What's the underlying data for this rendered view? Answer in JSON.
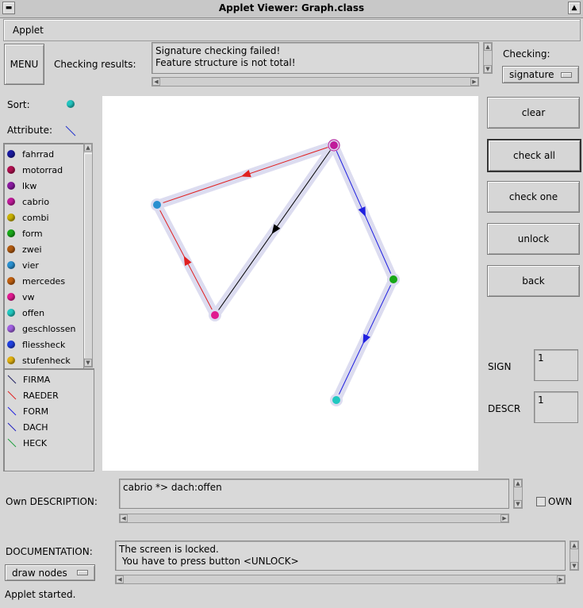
{
  "window": {
    "title": "Applet Viewer: Graph.class"
  },
  "menubar": {
    "applet_label": "Applet"
  },
  "header": {
    "menu_button": "MENU",
    "checking_results_label": "Checking results:",
    "results_text": "Signature checking failed!\nFeature structure is not total!",
    "checking_label": "Checking:",
    "checking_value": "signature"
  },
  "left": {
    "sort_label": "Sort:",
    "sort_color": "#22c5c0",
    "attribute_label": "Attribute:",
    "attribute_color": "#2233cc",
    "sorts": [
      {
        "label": "fahrrad",
        "color": "#1a1aa0"
      },
      {
        "label": "motorrad",
        "color": "#b01050"
      },
      {
        "label": "lkw",
        "color": "#8a1aa0"
      },
      {
        "label": "cabrio",
        "color": "#c01a9a"
      },
      {
        "label": "combi",
        "color": "#c8b000"
      },
      {
        "label": "form",
        "color": "#18a818"
      },
      {
        "label": "zwei",
        "color": "#b05a10"
      },
      {
        "label": "vier",
        "color": "#2a90d0"
      },
      {
        "label": "mercedes",
        "color": "#c06010"
      },
      {
        "label": "vw",
        "color": "#e01a90"
      },
      {
        "label": "offen",
        "color": "#20c8c0"
      },
      {
        "label": "geschlossen",
        "color": "#a060e0"
      },
      {
        "label": "fliessheck",
        "color": "#2040e0"
      },
      {
        "label": "stufenheck",
        "color": "#e0b010"
      }
    ],
    "attributes": [
      {
        "label": "FIRMA",
        "color": "#202060"
      },
      {
        "label": "RAEDER",
        "color": "#e02020"
      },
      {
        "label": "FORM",
        "color": "#2020e0"
      },
      {
        "label": "DACH",
        "color": "#2020c0"
      },
      {
        "label": "HECK",
        "color": "#20a040"
      }
    ]
  },
  "right": {
    "buttons": [
      "clear",
      "check all",
      "check one",
      "unlock",
      "back"
    ],
    "sign_label": "SIGN",
    "sign_value": "1",
    "descr_label": "DESCR",
    "descr_value": "1"
  },
  "graph": {
    "nodes": [
      {
        "id": "top",
        "color": "#c01a9a"
      },
      {
        "id": "left",
        "color": "#2a90d0"
      },
      {
        "id": "bottom",
        "color": "#e01a90"
      },
      {
        "id": "right",
        "color": "#18a818"
      },
      {
        "id": "end",
        "color": "#20c8c0"
      }
    ],
    "edges": [
      {
        "from": "top",
        "to": "left",
        "color": "#e02020"
      },
      {
        "from": "top",
        "to": "bottom",
        "color": "#000000"
      },
      {
        "from": "bottom",
        "to": "left",
        "color": "#e02020"
      },
      {
        "from": "top",
        "to": "right",
        "color": "#2020e0"
      },
      {
        "from": "right",
        "to": "end",
        "color": "#2020e0"
      }
    ]
  },
  "own": {
    "label": "Own DESCRIPTION:",
    "value": "cabrio *> dach:offen",
    "checkbox_label": "OWN"
  },
  "doc": {
    "label": "DOCUMENTATION:",
    "text": "The screen is locked.\n You have to press button <UNLOCK>",
    "draw_select": "draw nodes"
  },
  "status": {
    "text": "Applet started."
  }
}
